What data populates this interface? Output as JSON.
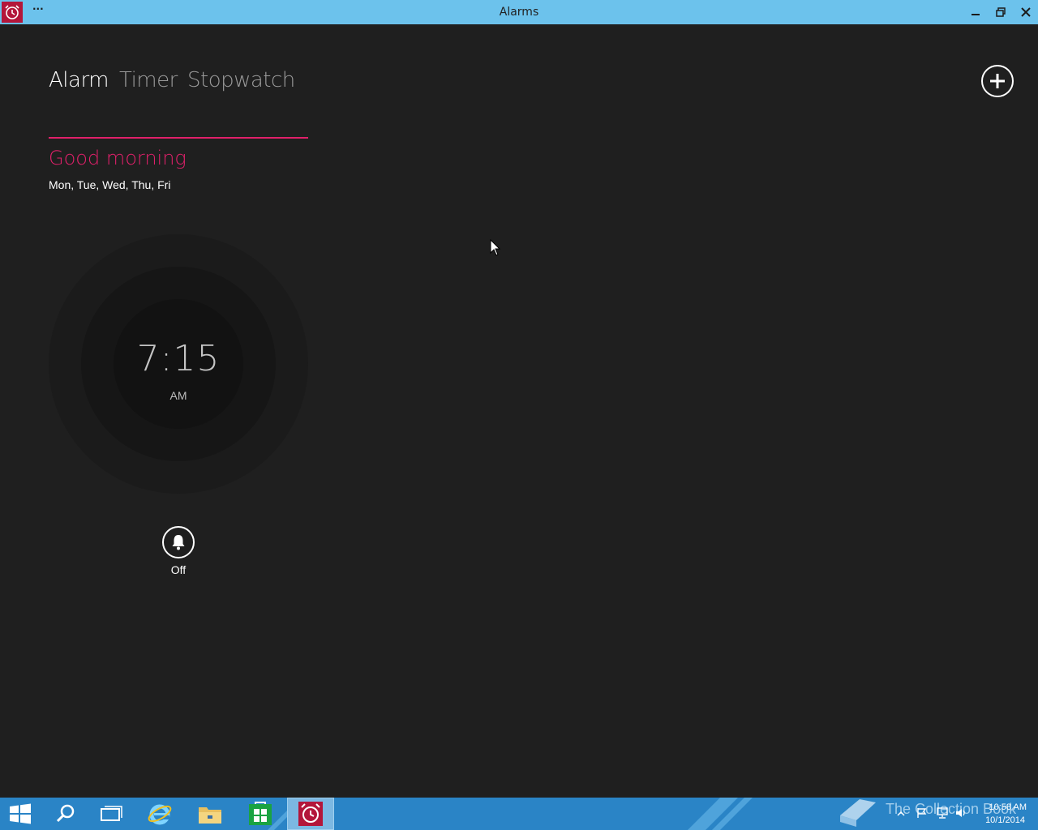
{
  "window": {
    "title": "Alarms",
    "menu_glyph": "···",
    "icon": "alarm-clock-icon",
    "controls": [
      "minimize-icon",
      "restore-icon",
      "close-icon"
    ]
  },
  "tabs": [
    {
      "label": "Alarm",
      "active": true
    },
    {
      "label": "Timer",
      "active": false
    },
    {
      "label": "Stopwatch",
      "active": false
    }
  ],
  "add_button": {
    "icon": "plus-icon"
  },
  "alarm": {
    "name": "Good morning",
    "days": "Mon, Tue, Wed, Thu, Fri",
    "time": "7:15",
    "ampm": "AM",
    "toggle_icon": "bell-icon",
    "toggle_label": "Off",
    "accent_color": "#e0206a"
  },
  "taskbar": {
    "items": [
      "start-icon",
      "search-icon",
      "task-view-icon",
      "internet-explorer-icon",
      "file-explorer-icon",
      "store-icon",
      "alarms-app-icon"
    ],
    "watermark": "The Collection Book",
    "tray": [
      "show-hidden-icons-icon",
      "action-center-flag-icon",
      "network-icon",
      "volume-icon"
    ],
    "clock_time": "10:58 AM",
    "clock_date": "10/1/2014",
    "color": "#2a84c6"
  },
  "colors": {
    "titlebar": "#6cc2ec",
    "background": "#1f1f1f",
    "accent": "#e0206a"
  }
}
